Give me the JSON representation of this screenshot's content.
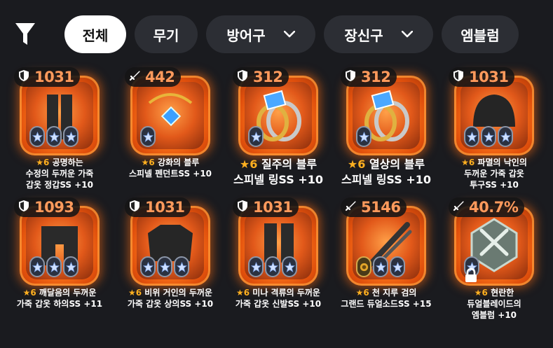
{
  "filters": {
    "tabs": [
      {
        "label": "전체",
        "active": true
      },
      {
        "label": "무기",
        "active": false
      },
      {
        "label": "방어구",
        "active": false,
        "dropdown": true
      },
      {
        "label": "장신구",
        "active": false,
        "dropdown": true
      },
      {
        "label": "엠블럼",
        "active": false
      }
    ]
  },
  "colors": {
    "background": "#1a1b1f",
    "chip": "#2c2e34",
    "badge_text": "#ff9a5c",
    "star": "#ffb020",
    "frame": "#ff7a1c"
  },
  "items": [
    {
      "type_icon": "shield-icon",
      "value": "1031",
      "star": "★6",
      "name": "공명하는 수정의 두꺼운 가죽 갑옷 정갑SS +10",
      "lines": [
        "공명하는",
        "수정의 두꺼운 가죽",
        "갑옷 정갑SS +10"
      ],
      "slots": [
        "star",
        "star",
        "star"
      ],
      "art": "legs"
    },
    {
      "type_icon": "sword-icon",
      "value": "442",
      "star": "★6",
      "name": "강화의 블루 스피넬 펜던트SS +10",
      "lines": [
        "강화의 블루",
        "스피넬 펜던트SS +10"
      ],
      "slots": [
        "star"
      ],
      "art": "pendant"
    },
    {
      "type_icon": "shield-icon",
      "value": "312",
      "star": "★6",
      "name": "질주의 블루 스피넬 링SS +10",
      "lines": [
        "질주의 블루",
        "스피넬 링SS +10"
      ],
      "slots": [
        "star"
      ],
      "art": "ring",
      "big": true
    },
    {
      "type_icon": "shield-icon",
      "value": "312",
      "star": "★6",
      "name": "열상의 블루 스피넬 링SS +10",
      "lines": [
        "열상의 블루",
        "스피넬 링SS +10"
      ],
      "slots": [
        "star"
      ],
      "art": "ring",
      "big": true
    },
    {
      "type_icon": "shield-icon",
      "value": "1031",
      "star": "★6",
      "name": "파멸의 낙인의 두꺼운 가죽 갑옷 투구SS +10",
      "lines": [
        "파멸의 낙인의",
        "두꺼운 가죽 갑옷",
        "투구SS +10"
      ],
      "slots": [
        "star",
        "star",
        "star"
      ],
      "art": "helm"
    },
    {
      "type_icon": "shield-icon",
      "value": "1093",
      "star": "★6",
      "name": "깨달음의 두꺼운 가죽 갑옷 하의SS +11",
      "lines": [
        "깨달음의 두꺼운",
        "가죽 갑옷 하의SS +11"
      ],
      "slots": [
        "star",
        "star",
        "star"
      ],
      "art": "pants"
    },
    {
      "type_icon": "shield-icon",
      "value": "1031",
      "star": "★6",
      "name": "비위 거인의 두꺼운 가죽 갑옷 상의SS +10",
      "lines": [
        "비위 거인의 두꺼운",
        "가죽 갑옷 상의SS +10"
      ],
      "slots": [
        "star",
        "star",
        "star"
      ],
      "art": "chest"
    },
    {
      "type_icon": "shield-icon",
      "value": "1031",
      "star": "★6",
      "name": "미나 격류의 두꺼운 가죽 갑옷 신발SS +10",
      "lines": [
        "미나 격류의 두꺼운",
        "가죽 갑옷 신발SS +10"
      ],
      "slots": [
        "star",
        "star",
        "star"
      ],
      "art": "boots"
    },
    {
      "type_icon": "sword-icon",
      "value": "5146",
      "star": "★6",
      "name": "천 지루 검의 그랜드 듀얼소드SS +15",
      "lines": [
        "천 지루 검의",
        "그랜드 듀얼소드SS +15"
      ],
      "slots": [
        "gold",
        "star",
        "star"
      ],
      "art": "swords"
    },
    {
      "type_icon": "sword-icon",
      "value": "40.7%",
      "star": "★6",
      "name": "현란한 듀얼블레이드의 엠블럼 +10",
      "lines": [
        "현란한",
        "듀얼블레이드의",
        "엠블럼 +10"
      ],
      "slots": [
        "star"
      ],
      "art": "emblem",
      "locked": true
    }
  ]
}
